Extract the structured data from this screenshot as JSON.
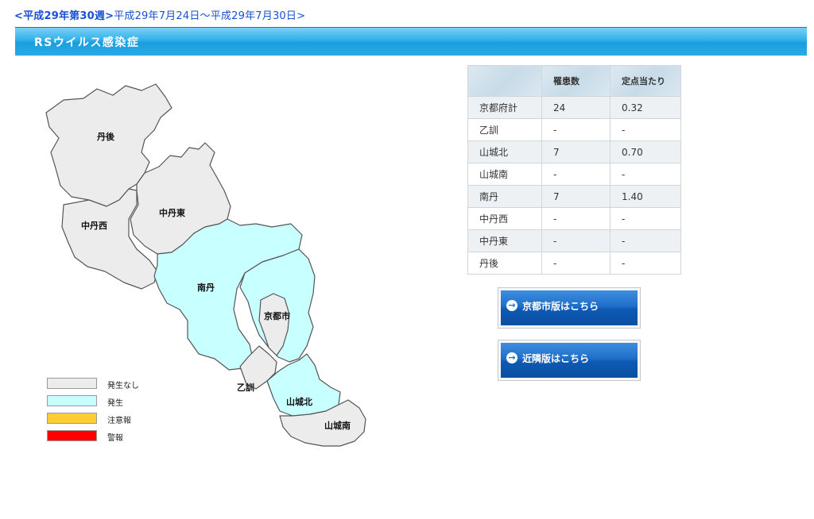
{
  "header": {
    "week_link": "<平成29年第30週>",
    "date_range": "平成29年7月24日～平成29年7月30日>"
  },
  "title": "RSウイルス感染症",
  "colors": {
    "none": "#ececec",
    "occurred": "#c8ffff",
    "caution": "#ffcc33",
    "warning": "#ff0000",
    "title_bar": "#22a3e3",
    "button": "#1a68c2"
  },
  "map": {
    "regions": {
      "tango": "丹後",
      "nakatango_nishi": "中丹西",
      "nakatango_higashi": "中丹東",
      "nantan": "南丹",
      "kyoto_city": "京都市",
      "otokuni": "乙訓",
      "yamashiro_kita": "山城北",
      "yamashiro_minami": "山城南"
    },
    "status": {
      "tango": "none",
      "nakatango_nishi": "none",
      "nakatango_higashi": "none",
      "nantan": "occurred",
      "kyoto_city": "occurred",
      "otokuni": "none",
      "yamashiro_kita": "occurred",
      "yamashiro_minami": "none"
    }
  },
  "legend": [
    {
      "label": "発生なし",
      "color": "#ececec"
    },
    {
      "label": "発生",
      "color": "#c8ffff"
    },
    {
      "label": "注意報",
      "color": "#ffcc33"
    },
    {
      "label": "警報",
      "color": "#ff0000"
    }
  ],
  "table": {
    "headers": [
      "",
      "罹患数",
      "定点当たり"
    ],
    "rows": [
      [
        "京都府計",
        "24",
        "0.32"
      ],
      [
        "乙訓",
        "-",
        "-"
      ],
      [
        "山城北",
        "7",
        "0.70"
      ],
      [
        "山城南",
        "-",
        "-"
      ],
      [
        "南丹",
        "7",
        "1.40"
      ],
      [
        "中丹西",
        "-",
        "-"
      ],
      [
        "中丹東",
        "-",
        "-"
      ],
      [
        "丹後",
        "-",
        "-"
      ]
    ]
  },
  "buttons": {
    "kyoto_city": "京都市版はこちら",
    "kinki": "近隣版はこちら"
  }
}
